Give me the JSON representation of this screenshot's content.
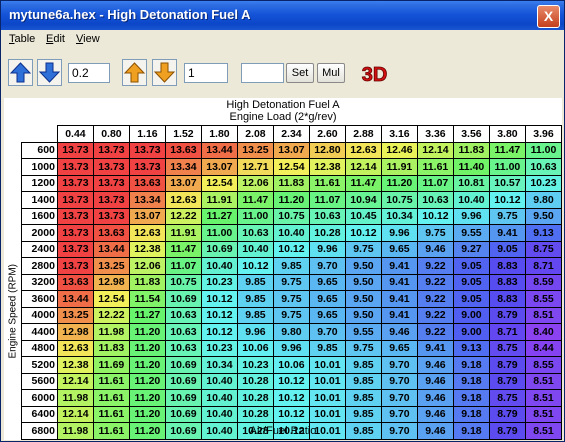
{
  "window": {
    "title": "mytune6a.hex - High Detonation Fuel A",
    "close_label": "X"
  },
  "menu": [
    "Table",
    "Edit",
    "View"
  ],
  "toolbar": {
    "step_value": "0.2",
    "step_value2": "1",
    "input3": "",
    "set_label": "Set",
    "mul_label": "Mul",
    "label_3d": "3D"
  },
  "map": {
    "title": "High Detonation Fuel A",
    "x_label": "Engine Load (2*g/rev)",
    "y_label": "Engine Speed (RPM)",
    "bottom_label": "Air/Fuel Ratio",
    "columns": [
      "0.44",
      "0.80",
      "1.16",
      "1.52",
      "1.80",
      "2.08",
      "2.34",
      "2.60",
      "2.88",
      "3.16",
      "3.36",
      "3.56",
      "3.80",
      "3.96"
    ],
    "rows": [
      {
        "rpm": "600",
        "v": [
          "13.73",
          "13.73",
          "13.73",
          "13.63",
          "13.44",
          "13.25",
          "13.07",
          "12.80",
          "12.63",
          "12.46",
          "12.14",
          "11.83",
          "11.47",
          "11.00"
        ]
      },
      {
        "rpm": "1000",
        "v": [
          "13.73",
          "13.73",
          "13.73",
          "13.34",
          "13.07",
          "12.71",
          "12.54",
          "12.38",
          "12.14",
          "11.91",
          "11.61",
          "11.40",
          "11.00",
          "10.63"
        ]
      },
      {
        "rpm": "1200",
        "v": [
          "13.73",
          "13.73",
          "13.63",
          "13.07",
          "12.54",
          "12.06",
          "11.83",
          "11.61",
          "11.47",
          "11.20",
          "11.07",
          "10.81",
          "10.57",
          "10.23"
        ]
      },
      {
        "rpm": "1400",
        "v": [
          "13.73",
          "13.73",
          "13.34",
          "12.63",
          "11.91",
          "11.47",
          "11.20",
          "11.07",
          "10.94",
          "10.75",
          "10.63",
          "10.40",
          "10.12",
          "9.80"
        ]
      },
      {
        "rpm": "1600",
        "v": [
          "13.73",
          "13.73",
          "13.07",
          "12.22",
          "11.27",
          "11.00",
          "10.75",
          "10.63",
          "10.45",
          "10.34",
          "10.12",
          "9.96",
          "9.75",
          "9.50"
        ]
      },
      {
        "rpm": "2000",
        "v": [
          "13.73",
          "13.63",
          "12.63",
          "11.91",
          "11.00",
          "10.63",
          "10.40",
          "10.28",
          "10.12",
          "9.96",
          "9.75",
          "9.55",
          "9.41",
          "9.13"
        ]
      },
      {
        "rpm": "2400",
        "v": [
          "13.73",
          "13.44",
          "12.38",
          "11.47",
          "10.69",
          "10.40",
          "10.12",
          "9.96",
          "9.75",
          "9.65",
          "9.46",
          "9.27",
          "9.05",
          "8.75"
        ]
      },
      {
        "rpm": "2800",
        "v": [
          "13.73",
          "13.25",
          "12.06",
          "11.07",
          "10.40",
          "10.12",
          "9.85",
          "9.70",
          "9.50",
          "9.41",
          "9.22",
          "9.05",
          "8.83",
          "8.71"
        ]
      },
      {
        "rpm": "3200",
        "v": [
          "13.63",
          "12.98",
          "11.83",
          "10.75",
          "10.23",
          "9.85",
          "9.75",
          "9.65",
          "9.50",
          "9.41",
          "9.22",
          "9.05",
          "8.83",
          "8.59"
        ]
      },
      {
        "rpm": "3600",
        "v": [
          "13.44",
          "12.54",
          "11.54",
          "10.69",
          "10.12",
          "9.85",
          "9.75",
          "9.65",
          "9.50",
          "9.41",
          "9.22",
          "9.05",
          "8.83",
          "8.55"
        ]
      },
      {
        "rpm": "4000",
        "v": [
          "13.25",
          "12.22",
          "11.27",
          "10.63",
          "10.12",
          "9.85",
          "9.75",
          "9.65",
          "9.50",
          "9.41",
          "9.22",
          "9.00",
          "8.79",
          "8.51"
        ]
      },
      {
        "rpm": "4400",
        "v": [
          "12.98",
          "11.98",
          "11.20",
          "10.63",
          "10.12",
          "9.96",
          "9.80",
          "9.70",
          "9.55",
          "9.46",
          "9.22",
          "9.00",
          "8.71",
          "8.40"
        ]
      },
      {
        "rpm": "4800",
        "v": [
          "12.63",
          "11.83",
          "11.20",
          "10.63",
          "10.23",
          "10.06",
          "9.96",
          "9.85",
          "9.75",
          "9.65",
          "9.41",
          "9.13",
          "8.75",
          "8.44"
        ]
      },
      {
        "rpm": "5200",
        "v": [
          "12.38",
          "11.69",
          "11.20",
          "10.69",
          "10.34",
          "10.23",
          "10.06",
          "10.01",
          "9.85",
          "9.70",
          "9.46",
          "9.18",
          "8.79",
          "8.55"
        ]
      },
      {
        "rpm": "5600",
        "v": [
          "12.14",
          "11.61",
          "11.20",
          "10.69",
          "10.40",
          "10.28",
          "10.12",
          "10.01",
          "9.85",
          "9.70",
          "9.46",
          "9.18",
          "8.79",
          "8.51"
        ]
      },
      {
        "rpm": "6000",
        "v": [
          "11.98",
          "11.61",
          "11.20",
          "10.69",
          "10.40",
          "10.28",
          "10.12",
          "10.01",
          "9.85",
          "9.70",
          "9.46",
          "9.18",
          "8.75",
          "8.51"
        ]
      },
      {
        "rpm": "6400",
        "v": [
          "12.14",
          "11.61",
          "11.20",
          "10.69",
          "10.40",
          "10.28",
          "10.12",
          "10.01",
          "9.85",
          "9.70",
          "9.46",
          "9.18",
          "8.79",
          "8.51"
        ]
      },
      {
        "rpm": "6800",
        "v": [
          "11.98",
          "11.61",
          "11.20",
          "10.69",
          "10.40",
          "10.28",
          "10.12",
          "10.01",
          "9.85",
          "9.70",
          "9.46",
          "9.18",
          "8.79",
          "8.51"
        ]
      }
    ]
  },
  "colors": {
    "rich_red": "#e8282a",
    "lean_violet": "#a070f0",
    "titlebar": "#0b46c8",
    "arrow_blue": "#2f6fd8",
    "arrow_orange": "#f0a020"
  },
  "icons": [
    "up-arrow-blue-icon",
    "down-arrow-blue-icon",
    "up-arrow-orange-icon",
    "down-arrow-orange-icon",
    "close-icon"
  ]
}
